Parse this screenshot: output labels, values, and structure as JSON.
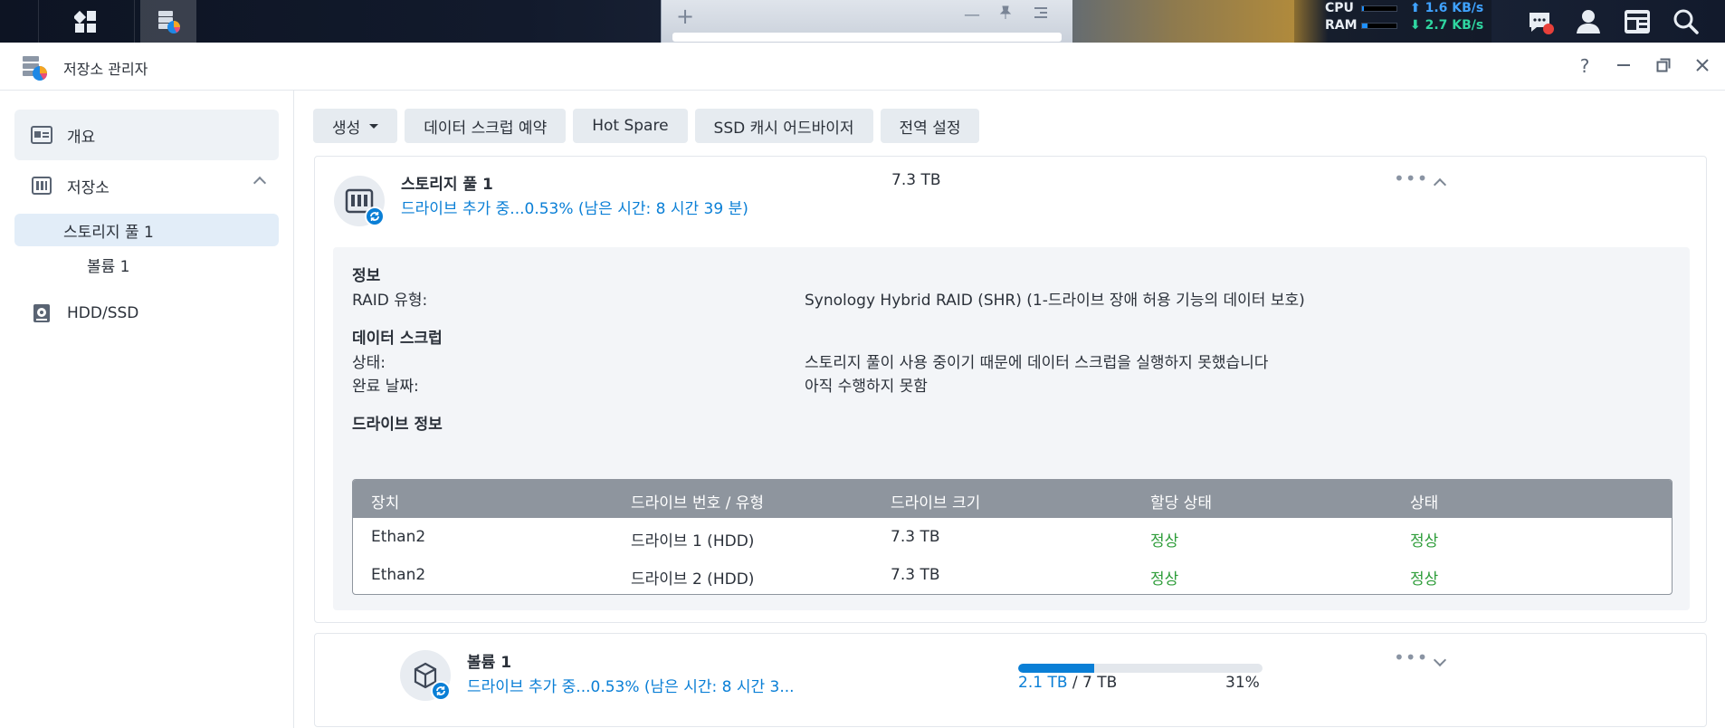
{
  "taskbar": {
    "cpu_label": "CPU",
    "ram_label": "RAM",
    "cpu_level": 0.05,
    "ram_level": 0.15,
    "upload_rate": "1.6 KB/s",
    "download_rate": "2.7 KB/s",
    "upload_arrow": "⬆",
    "download_arrow": "⬇",
    "colors": {
      "upload": "#3fa2ff",
      "download": "#2fd6a0",
      "alert": "#e8403a"
    }
  },
  "window": {
    "title": "저장소 관리자",
    "buttons": {
      "help": "?",
      "minimize": "–",
      "restore": "⧉",
      "close": "✕"
    }
  },
  "sidebar": {
    "overview": "개요",
    "storage": "저장소",
    "pool": "스토리지 풀 1",
    "volume": "볼륨 1",
    "hdd": "HDD/SSD"
  },
  "toolbar": {
    "create": "생성",
    "scrub_schedule": "데이터 스크럽 예약",
    "hot_spare": "Hot Spare",
    "ssd_advisor": "SSD 캐시 어드바이저",
    "global_settings": "전역 설정"
  },
  "pool": {
    "title": "스토리지 풀 1",
    "status": "드라이브 추가 중...0.53% (남은 시간: 8 시간 39 분)",
    "size": "7.3 TB",
    "more": "•••",
    "info_heading": "정보",
    "raid_label": "RAID 유형:",
    "raid_value": "Synology Hybrid RAID (SHR) (1-드라이브 장애 허용 기능의 데이터 보호)",
    "scrub_heading": "데이터 스크럽",
    "scrub_status_label": "상태:",
    "scrub_status_value": "스토리지 풀이 사용 중이기 때문에 데이터 스크럽을 실행하지 못했습니다",
    "scrub_done_label": "완료 날짜:",
    "scrub_done_value": "아직 수행하지 못함",
    "drive_heading": "드라이브 정보",
    "drive_table": {
      "headers": [
        "장치",
        "드라이브 번호 / 유형",
        "드라이브 크기",
        "할당 상태",
        "상태"
      ],
      "rows": [
        [
          "Ethan2",
          "드라이브 1 (HDD)",
          "7.3 TB",
          "정상",
          "정상"
        ],
        [
          "Ethan2",
          "드라이브 2 (HDD)",
          "7.3 TB",
          "정상",
          "정상"
        ]
      ]
    }
  },
  "volume": {
    "title": "볼륨 1",
    "status": "드라이브 추가 중...0.53% (남은 시간: 8 시간 3...",
    "used": "2.1 TB",
    "separator": " / ",
    "total": "7 TB",
    "percent": "31%",
    "usage_fraction": 0.31,
    "more": "•••"
  },
  "colors": {
    "accent": "#0a7fd6",
    "ok": "#2e9d3a",
    "table_header": "#8e959e"
  }
}
